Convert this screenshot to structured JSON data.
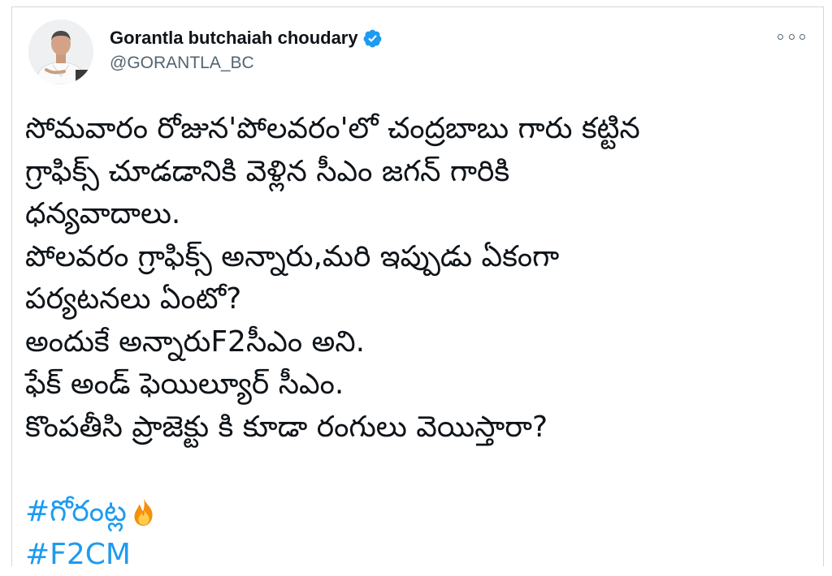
{
  "tweet": {
    "author": {
      "name": "Gorantla butchaiah choudary",
      "handle": "@GORANTLA_BC",
      "verified": true
    },
    "lines": [
      "సోమవారం రోజున'పోలవరం'లో చంద్రబాబు గారు కట్టిన",
      "గ్రాఫిక్స్ చూడడానికి వెళ్లిన సీఎం జగన్ గారికి",
      "ధన్యవాదాలు.",
      "పోలవరం గ్రాఫిక్స్ అన్నారు,మరి ఇప్పుడు ఏకంగా",
      "పర్యటనలు ఏంటో?",
      "అందుకే అన్నారుF2సీఎం అని.",
      "ఫేక్ అండ్ ఫెయిల్యూర్ సీఎం.",
      "కొంపతీసి ప్రాజెక్టు కి కూడా రంగులు వెయిస్తారా?"
    ],
    "hashtags": [
      {
        "text": "#గోరంట్ల",
        "emoji": "fire-icon"
      },
      {
        "text": "#F2CM"
      }
    ]
  },
  "colors": {
    "link": "#1d9bf0",
    "text": "#0f1419",
    "secondary": "#536471",
    "verified": "#1d9bf0"
  }
}
